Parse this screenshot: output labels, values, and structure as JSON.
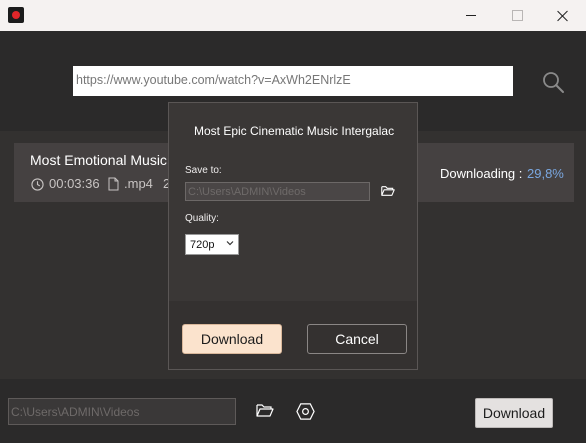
{
  "url_input": {
    "value": "https://www.youtube.com/watch?v=AxWh2ENrlzE"
  },
  "download_item": {
    "title": "Most Emotional Music",
    "duration": "00:03:36",
    "format": ".mp4",
    "extra": "2",
    "status_label": "Downloading :",
    "progress": "29,8%",
    "progress_color": "#7aa7e0"
  },
  "bottom_bar": {
    "path": "C:\\Users\\ADMIN\\Videos",
    "download_label": "Download"
  },
  "dialog": {
    "title": "Most Epic Cinematic Music Intergalact",
    "save_to_label": "Save to:",
    "save_path": "C:\\Users\\ADMIN\\Videos",
    "quality_label": "Quality:",
    "quality_value": "720p",
    "download_label": "Download",
    "cancel_label": "Cancel",
    "download_button_color": "#fbe3cd"
  },
  "icons": [
    "app-icon",
    "minimize-icon",
    "maximize-icon",
    "close-icon",
    "search-icon",
    "clock-icon",
    "file-icon",
    "folder-icon",
    "settings-icon",
    "chevron-down-icon"
  ]
}
